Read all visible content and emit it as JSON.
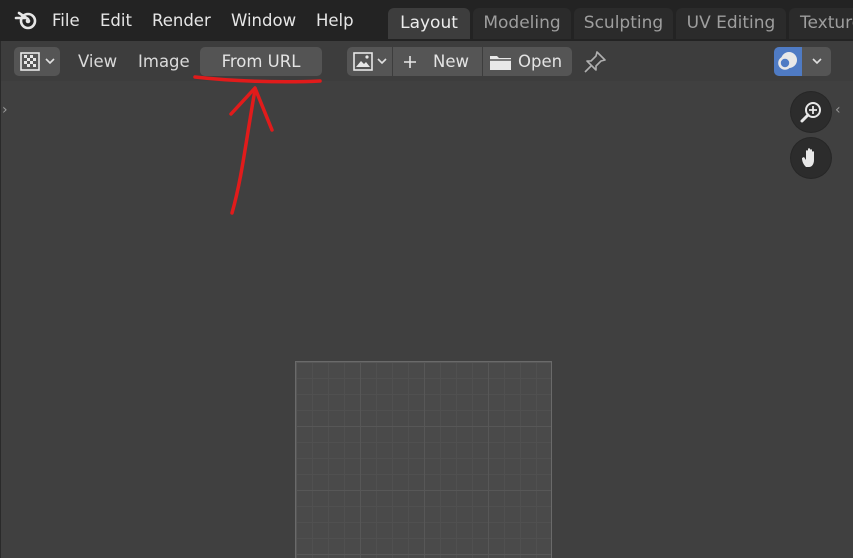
{
  "app": {
    "menu": [
      "File",
      "Edit",
      "Render",
      "Window",
      "Help"
    ],
    "workspace_tabs": [
      "Layout",
      "Modeling",
      "Sculpting",
      "UV Editing",
      "Texture"
    ],
    "active_tab": "Layout"
  },
  "editor_header": {
    "editor_type_icon": "image-editor-icon",
    "view_label": "View",
    "image_label": "Image",
    "from_url_label": "From URL",
    "browse_image_icon": "image-browse-icon",
    "new_label": "New",
    "open_label": "Open",
    "pin_icon": "pin-icon",
    "overlay_icon": "overlay-icon"
  },
  "navigation_gizmo": [
    "zoom-icon",
    "hand-pan-icon"
  ],
  "annotation": {
    "color": "#e11b1b",
    "target": "From URL"
  },
  "colors": {
    "topbar_bg": "#232323",
    "editor_bg": "#404040",
    "header_bg": "#3d3d3d",
    "button_bg": "#555555",
    "accent_blue": "#4f7bc4"
  }
}
